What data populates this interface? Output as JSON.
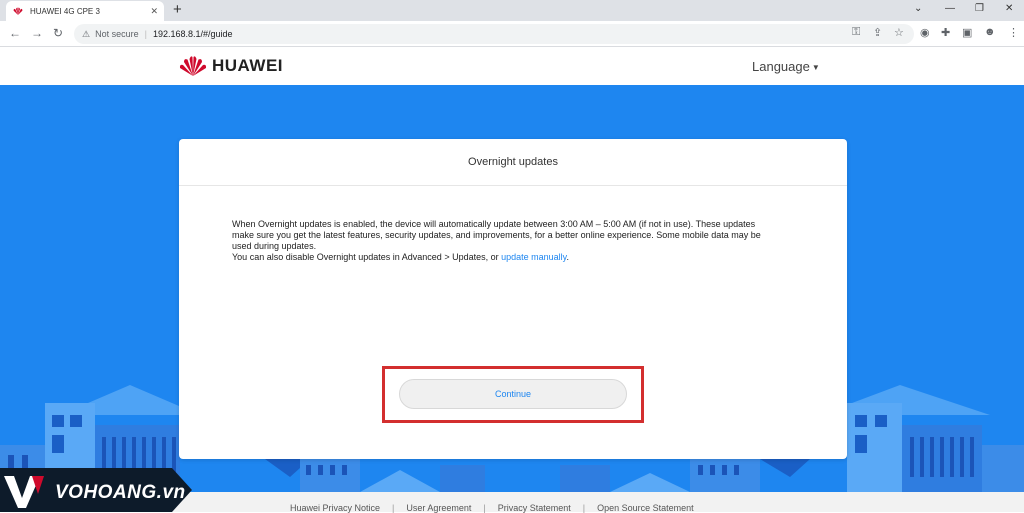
{
  "browser": {
    "tab_title": "HUAWEI 4G CPE 3",
    "tab_close": "✕",
    "new_tab": "+",
    "security_label": "Not secure",
    "url": "192.168.8.1/#/guide",
    "icons": [
      "back-icon",
      "forward-icon",
      "reload-icon",
      "warning-icon",
      "key-icon",
      "share-icon",
      "star-icon",
      "extension-icon",
      "puzzle-icon",
      "sidepanel-icon",
      "profile-icon",
      "menu-icon"
    ]
  },
  "header": {
    "logo_text": "HUAWEI",
    "language_label": "Language",
    "brand_color": "#cf0a2c"
  },
  "dialog": {
    "title": "Overnight updates",
    "body_line1": "When Overnight updates is enabled, the device will automatically update between 3:00 AM – 5:00 AM (if not in use). These updates",
    "body_line2": "make sure you get the latest features, security updates, and improvements, for a better online experience. Some mobile data may be",
    "body_line3": "used during updates.",
    "body_line4_prefix": "You can also disable Overnight updates in Advanced > Updates, or ",
    "body_link": "update manually",
    "body_line4_suffix": ".",
    "continue_label": "Continue"
  },
  "footer": {
    "links": [
      "Huawei Privacy Notice",
      "User Agreement",
      "Privacy Statement",
      "Open Source Statement"
    ],
    "separator": "|"
  },
  "watermark": {
    "text": "VOHOANG.vn"
  },
  "colors": {
    "background_blue": "#1e86f0",
    "link_blue": "#1e86f0",
    "highlight_red": "#d32f2f"
  }
}
